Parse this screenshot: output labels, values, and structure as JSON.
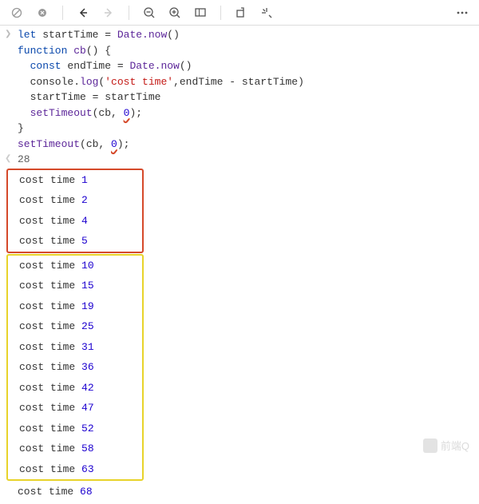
{
  "toolbar": {
    "clear": "clear-icon",
    "close": "close-icon",
    "back": "back-arrow-icon",
    "forward": "forward-arrow-icon",
    "zoom_out": "zoom-out-icon",
    "zoom_in": "zoom-in-icon",
    "viewport": "viewport-icon",
    "step": "step-icon",
    "debug": "debug-tools-icon",
    "more": "more-icon"
  },
  "code": {
    "l1": {
      "kw": "let",
      "id": " startTime ",
      "eq": "= ",
      "fn": "Date.now",
      "paren": "()"
    },
    "l2": {
      "kw": "function",
      "id": " cb",
      "paren": "() {"
    },
    "l3": {
      "kw": "  const",
      "id": " endTime ",
      "eq": "= ",
      "fn": "Date.now",
      "paren": "()"
    },
    "l4": {
      "id": "  console.",
      "fn": "log",
      "paren1": "(",
      "str": "'cost time'",
      "rest": ",endTime - startTime)"
    },
    "l5": "  startTime = startTime",
    "l6": {
      "fn": "  setTimeout",
      "paren1": "(cb, ",
      "num": "0",
      "paren2": ");"
    },
    "l7": "}",
    "l8": {
      "fn": "setTimeout",
      "paren1": "(cb, ",
      "num": "0",
      "paren2": ");"
    }
  },
  "result": "28",
  "log_label": "cost time",
  "logs_red": [
    1,
    2,
    4,
    5
  ],
  "logs_yellow": [
    10,
    15,
    19,
    25,
    31,
    36,
    42,
    47,
    52,
    58,
    63
  ],
  "logs_plain": [
    68
  ],
  "watermark": "前端Q"
}
